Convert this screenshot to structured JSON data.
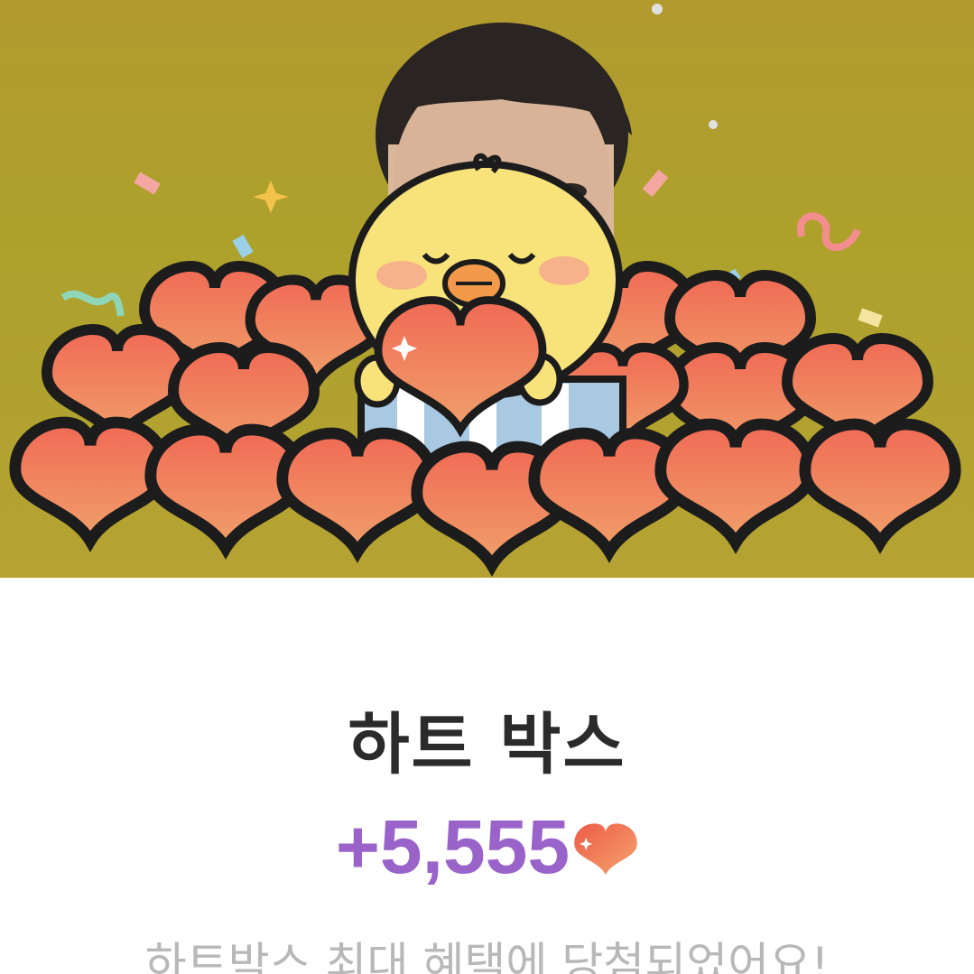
{
  "title": "하트 박스",
  "amount": "+5,555",
  "subtitle": "하트박스 최대 혜택에 당첨되었어요!",
  "icons": {
    "currency": "heart-icon",
    "mascot": "chick-mascot"
  },
  "colors": {
    "accent": "#9a63c9",
    "heart": "#ee6a4c",
    "header_bg": "#b09e2f"
  }
}
